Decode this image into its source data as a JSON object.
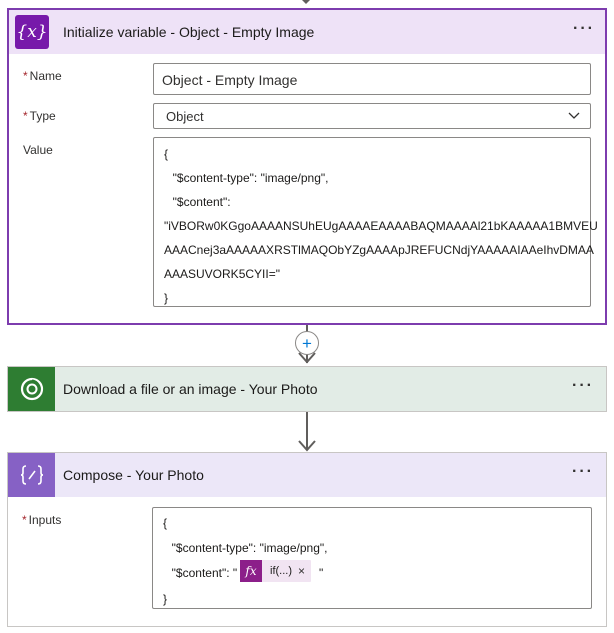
{
  "init_card": {
    "title": "Initialize variable - Object - Empty Image",
    "icon": "variable-icon",
    "name_label": "Name",
    "name_value": "Object - Empty Image",
    "type_label": "Type",
    "type_value": "Object",
    "value_label": "Value",
    "value_lines": [
      "{",
      "  \"$content-type\": \"image/png\",",
      "  \"$content\":",
      "\"iVBORw0KGgoAAAANSUhEUgAAAAEAAAABAQMAAAAl21bKAAAAA1BMVEU",
      "AAACnej3aAAAAAXRSTlMAQObYZgAAAApJREFUCNdjYAAAAAIAAeIhvDMAA",
      "AAASUVORK5CYII=\"",
      "}"
    ]
  },
  "download_card": {
    "title": "Download a file or an image - Your Photo",
    "icon": "dataverse-icon"
  },
  "compose_card": {
    "title": "Compose - Your Photo",
    "icon": "compose-icon",
    "inputs_label": "Inputs",
    "lines": [
      "{",
      "  \"$content-type\": \"image/png\",",
      "  \"$content\": \"",
      "\"",
      "}"
    ],
    "token_text": "if(...)",
    "token_fx": "fx",
    "token_close": "×"
  },
  "more_label": "···",
  "add_step": "+",
  "required_mark": "*",
  "colors": {
    "init_header": "#eee2f7",
    "init_border": "#7d3cae",
    "init_icon": "#7719aa",
    "download_header": "#e2ece6",
    "download_icon": "#2e7d32",
    "compose_header": "#ece7f8",
    "compose_icon": "#8661c5",
    "token_fx": "#8c1f8a"
  }
}
